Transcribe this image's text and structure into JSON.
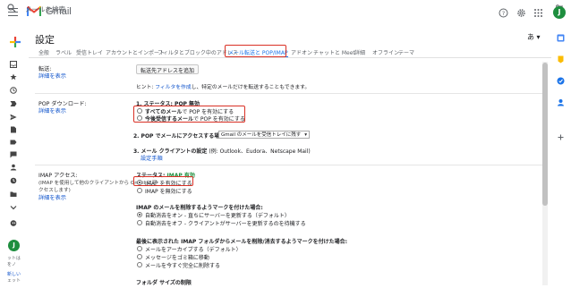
{
  "app": {
    "name": "Gmail"
  },
  "search": {
    "placeholder": "メールを検索"
  },
  "user": {
    "initial": "J"
  },
  "page": {
    "title": "設定",
    "lang": "あ ▾"
  },
  "tabs": [
    "全般",
    "ラベル",
    "受信トレイ",
    "アカウントとインポート",
    "フィルタとブロック中のアドレス",
    "メール転送と POP/IMAP",
    "アドオン",
    "チャットと Meet",
    "詳細",
    "オフライン",
    "テーマ"
  ],
  "forwarding": {
    "label": "転送:",
    "learn_more": "詳細を表示",
    "button": "転送先アドレスを追加",
    "hint_prefix": "ヒント: ",
    "hint_link": "フィルタを作成",
    "hint_suffix": "し、特定のメールだけを転送することもできます。"
  },
  "pop": {
    "label": "POP ダウンロード:",
    "learn_more": "詳細を表示",
    "status_prefix": "1. ステータス: ",
    "status_value": "POP 無効",
    "opt1_bold": "すべてのメール",
    "opt1_rest": "で POP を有効にする",
    "opt2_bold": "今後受信するメール",
    "opt2_rest": "で POP を有効にする",
    "step2": "2. POP でメールにアクセスする場合",
    "step2_select": "Gmail のメールを受信トレイに残す",
    "step3_bold": "3. メール クライアントの設定",
    "step3_rest": " (例: Outlook、Eudora、Netscape Mail)",
    "setup_link": "設定手順"
  },
  "imap": {
    "label": "IMAP アクセス:",
    "desc_line1": "(IMAP を使用して他のクライアントから Gmail にア",
    "desc_line2": "クセスします)",
    "learn_more": "詳細を表示",
    "status_prefix": "ステータス: ",
    "status_value": "IMAP 有効",
    "enable": "IMAP を有効にする",
    "disable": "IMAP を無効にする",
    "delete_heading": "IMAP のメールを削除するようマークを付けた場合:",
    "delete_opt1": "自動消去をオン - 直ちにサーバーを更新する（デフォルト）",
    "delete_opt2": "自動消去をオフ - クライアントがサーバーを更新するのを待機する",
    "expunge_heading": "最後に表示された IMAP フォルダからメールを削除/消去するようマークを付けた場合:",
    "expunge_opt1": "メールをアーカイブする（デフォルト）",
    "expunge_opt2": "メッセージをゴミ箱に移動",
    "expunge_opt3": "メールを今すぐ完全に削除する",
    "folder_limit": "フォルダ サイズの制限"
  },
  "leftrail": {
    "avatar_initial": "J",
    "snippet_line1": "ットは",
    "snippet_line2": "をノ",
    "snippet_link": "新しい",
    "snippet_line3": "ェット"
  },
  "colors": {
    "accent": "#1a73e8",
    "highlight": "#d93025",
    "enabled": "#1e8e3e"
  }
}
